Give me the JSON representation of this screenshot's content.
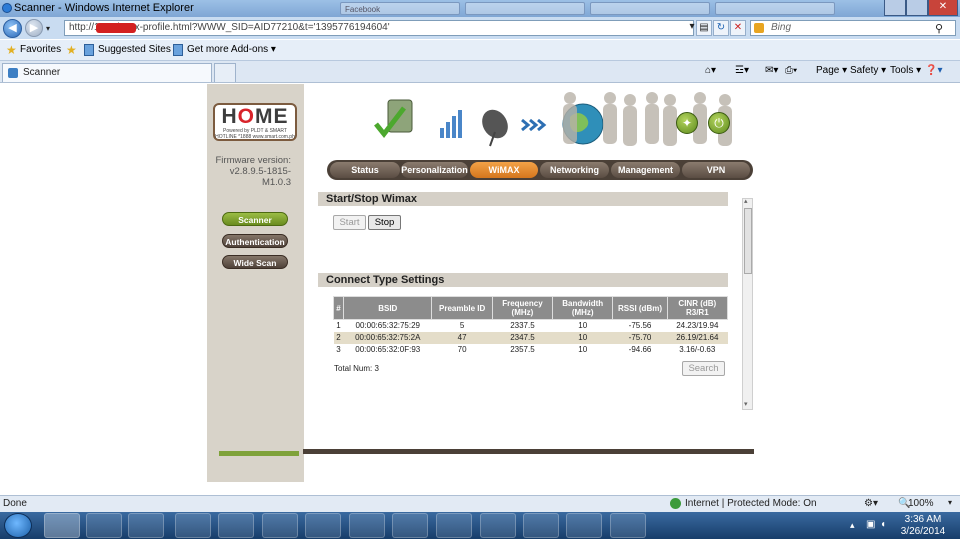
{
  "window": {
    "title": "Scanner - Windows Internet Explorer"
  },
  "ghost_tabs": [
    "Facebook",
    "",
    ""
  ],
  "address": {
    "url": "http://10.5        /wmx-profile.html?WWW_SID=AID77210&t='1395776194604'",
    "search_placeholder": "Bing"
  },
  "favorites": {
    "label": "Favorites",
    "suggested": "Suggested Sites ▾",
    "addons": "Get more Add-ons ▾"
  },
  "tab": {
    "label": "Scanner"
  },
  "commands": [
    "Page ▾",
    "Safety ▾",
    "Tools ▾"
  ],
  "logo": {
    "word": "HOME",
    "tag": "Powered by PLDT & SMART",
    "hotline": "HOTLINE *1888  www.smart.com.ph"
  },
  "firmware": {
    "label": "Firmware version:",
    "value": "v2.8.9.5-1815-M1.0.3"
  },
  "side_menu": [
    "Scanner",
    "Authentication",
    "Wide Scan"
  ],
  "nav_tabs": [
    "Status",
    "Personalization",
    "WiMAX",
    "Networking",
    "Management",
    "VPN"
  ],
  "start_stop": {
    "header": "Start/Stop Wimax",
    "start": "Start",
    "stop": "Stop"
  },
  "connect": {
    "header": "Connect Type Settings",
    "columns": [
      "#",
      "BSID",
      "Preamble ID",
      "Frequency (MHz)",
      "Bandwidth (MHz)",
      "RSSI (dBm)",
      "CINR (dB) R3/R1"
    ],
    "rows": [
      [
        "1",
        "00:00:65:32:75:29",
        "5",
        "2337.5",
        "10",
        "-75.56",
        "24.23/19.94"
      ],
      [
        "2",
        "00:00:65:32:75:2A",
        "47",
        "2347.5",
        "10",
        "-75.70",
        "26.19/21.64"
      ],
      [
        "3",
        "00:00:65:32:0F:93",
        "70",
        "2357.5",
        "10",
        "-94.66",
        "3.16/-0.63"
      ]
    ],
    "total": "Total Num: 3",
    "search": "Search"
  },
  "status": {
    "left": "Done",
    "zone": "Internet | Protected Mode: On",
    "zoom": "100%"
  },
  "clock": {
    "time": "3:36 AM",
    "date": "3/26/2014"
  }
}
